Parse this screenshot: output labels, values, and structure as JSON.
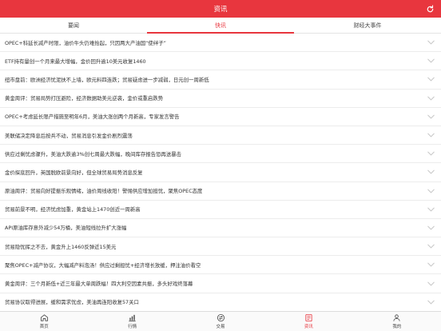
{
  "header": {
    "title": "资讯"
  },
  "tabs": [
    {
      "label": "要闻",
      "active": false
    },
    {
      "label": "快讯",
      "active": true
    },
    {
      "label": "财经大事件",
      "active": false
    }
  ],
  "news": [
    "OPEC+科延长减产时限，油价牛头仍难抬起，只因两大产油国“使绊子”",
    "ETF持有量创一个月来最大增幅，金价回升逾10美元收复1460",
    "纽市盘前：欧洲经济忧泥扶不上墙，欧元料四连跌；贸易疑虑进一步减弱，日元创一周新低",
    "黄金周评：贸易局势打压避险，经济数据助美元逆袭，金价或重启跌势",
    "OPEC+考虑延长限产措施至明年6月，美油大涨创两个月新高，专家发言警告",
    "美联储决定降息后按兵不动，贸易消息引发金价剧烈震荡",
    "供应过剩忧虑骤升，美油大跌逾3%创七周最大跌幅，晚间库存报告恐再送暴击",
    "金价探底回升，英国脱欧前景向好，但全球贸易局势消息反复",
    "原油周评：贸易向好提振乐观情绪，油价周线收阳！警惕供应增加担忧，聚焦OPEC态度",
    "贸易前景不明，经济忧虑加重，黄金站上1470创近一周新高",
    "API原油库存意外减少54万桶，美油短线拉升扩大涨幅",
    "贸易隐忧挥之不去，黄金升上1460反弹近15美元",
    "聚焦OPEC+减产协议，大幅减产料泡汤！供应过剩担忧+经济增长放缓，押注油价看空",
    "黄金周评：三个月新低+近三年最大单周跌幅！四大利空因素共振，多头好戏终落幕",
    "贸易协议取得进展，缓和需求忧虑，美油再连阳收复57关口"
  ],
  "bottom_nav": [
    {
      "label": "首页",
      "icon": "home-icon",
      "active": false
    },
    {
      "label": "行情",
      "icon": "market-chart-icon",
      "active": false
    },
    {
      "label": "交易",
      "icon": "trade-icon",
      "active": false
    },
    {
      "label": "资讯",
      "icon": "news-icon",
      "active": true
    },
    {
      "label": "我的",
      "icon": "profile-icon",
      "active": false
    }
  ],
  "colors": {
    "accent": "#e8363e"
  }
}
